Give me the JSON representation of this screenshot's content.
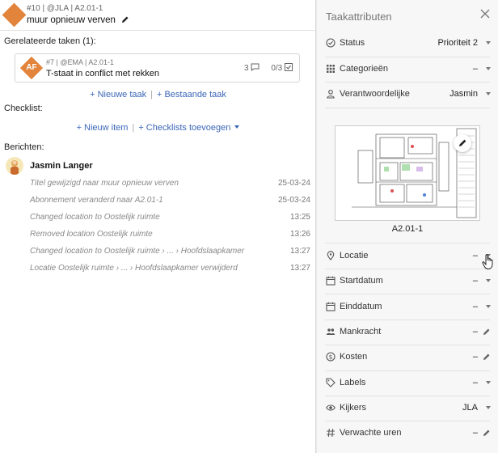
{
  "task": {
    "meta": "#10 | @JLA | A2.01-1",
    "title": "muur opnieuw verven"
  },
  "related": {
    "heading": "Gerelateerde taken (1):",
    "items": [
      {
        "meta": "#7 | @EMA | A2.01-1",
        "title": "T-staat in conflict met rekken",
        "initials": "AF",
        "comments": "3",
        "checks": "0/3"
      }
    ],
    "new_task": "+ Nieuwe taak",
    "existing_task": "+ Bestaande taak"
  },
  "checklist": {
    "heading": "Checklist:",
    "new_item": "+ Nieuw item",
    "add_checklists": "+ Checklists toevoegen"
  },
  "messages": {
    "heading": "Berichten:",
    "author": "Jasmin Langer",
    "events": [
      {
        "text": "Titel gewijzigd naar muur opnieuw verven",
        "time": "25-03-24"
      },
      {
        "text": "Abonnement veranderd naar A2.01-1",
        "time": "25-03-24"
      },
      {
        "text": "Changed location to Oostelijk ruimte",
        "time": "13:25"
      },
      {
        "text": "Removed location Oostelijk ruimte",
        "time": "13:26"
      },
      {
        "text": "Changed location to Oostelijk ruimte › ... › Hoofdslaapkamer",
        "time": "13:27"
      },
      {
        "text": "Locatie Oostelijk ruimte › ... › Hoofdslaapkamer verwijderd",
        "time": "13:27"
      }
    ]
  },
  "panel": {
    "title": "Taakattributen",
    "attrs_top": [
      {
        "label": "Status",
        "value": "Prioriteit 2",
        "icon": "check-circle-icon"
      },
      {
        "label": "Categorieën",
        "value": "–",
        "icon": "grid-icon"
      },
      {
        "label": "Verantwoordelijke",
        "value": "Jasmin",
        "icon": "person-icon"
      }
    ],
    "plan_label": "A2.01-1",
    "attrs_bottom": [
      {
        "label": "Locatie",
        "value": "–",
        "icon": "pin-icon",
        "ctrl": "dd"
      },
      {
        "label": "Startdatum",
        "value": "–",
        "icon": "calendar-icon",
        "ctrl": "dd"
      },
      {
        "label": "Einddatum",
        "value": "–",
        "icon": "calendar-icon",
        "ctrl": "dd"
      },
      {
        "label": "Mankracht",
        "value": "–",
        "icon": "people-icon",
        "ctrl": "pen"
      },
      {
        "label": "Kosten",
        "value": "–",
        "icon": "dollar-icon",
        "ctrl": "pen"
      },
      {
        "label": "Labels",
        "value": "–",
        "icon": "tag-icon",
        "ctrl": "dd"
      },
      {
        "label": "Kijkers",
        "value": "JLA",
        "icon": "eye-icon",
        "ctrl": "dd"
      },
      {
        "label": "Verwachte uren",
        "value": "–",
        "icon": "hash-icon",
        "ctrl": "pen"
      }
    ]
  }
}
